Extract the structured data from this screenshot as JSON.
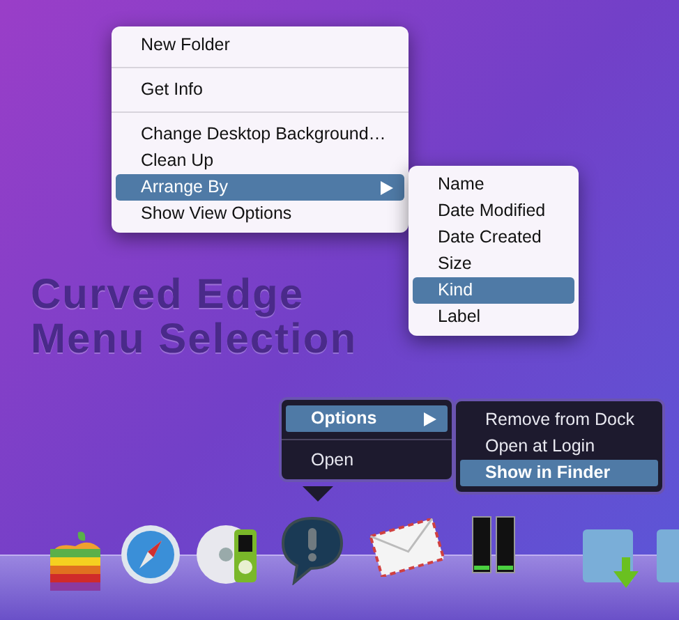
{
  "desktop_menu": {
    "items": [
      {
        "kind": "item",
        "label": "New Folder",
        "selected": false,
        "submenu": false
      },
      {
        "kind": "separator"
      },
      {
        "kind": "item",
        "label": "Get Info",
        "selected": false,
        "submenu": false
      },
      {
        "kind": "separator"
      },
      {
        "kind": "item",
        "label": "Change Desktop Background…",
        "selected": false,
        "submenu": false
      },
      {
        "kind": "item",
        "label": "Clean Up",
        "selected": false,
        "submenu": false
      },
      {
        "kind": "item",
        "label": "Arrange By",
        "selected": true,
        "submenu": true
      },
      {
        "kind": "item",
        "label": "Show View Options",
        "selected": false,
        "submenu": false
      }
    ]
  },
  "arrange_submenu": {
    "items": [
      {
        "label": "Name",
        "selected": false
      },
      {
        "label": "Date Modified",
        "selected": false
      },
      {
        "label": "Date Created",
        "selected": false
      },
      {
        "label": "Size",
        "selected": false
      },
      {
        "label": "Kind",
        "selected": true
      },
      {
        "label": "Label",
        "selected": false
      }
    ]
  },
  "headline": [
    "Curved Edge",
    "Menu Selection"
  ],
  "dock_menu": {
    "items": [
      {
        "kind": "item",
        "label": "Options",
        "selected": true,
        "submenu": true
      },
      {
        "kind": "separator"
      },
      {
        "kind": "item",
        "label": "Open",
        "selected": false,
        "submenu": false
      }
    ]
  },
  "options_submenu": {
    "items": [
      {
        "label": "Remove from Dock",
        "selected": false
      },
      {
        "label": "Open at Login",
        "selected": false
      },
      {
        "label": "Show in Finder",
        "selected": true
      }
    ]
  }
}
